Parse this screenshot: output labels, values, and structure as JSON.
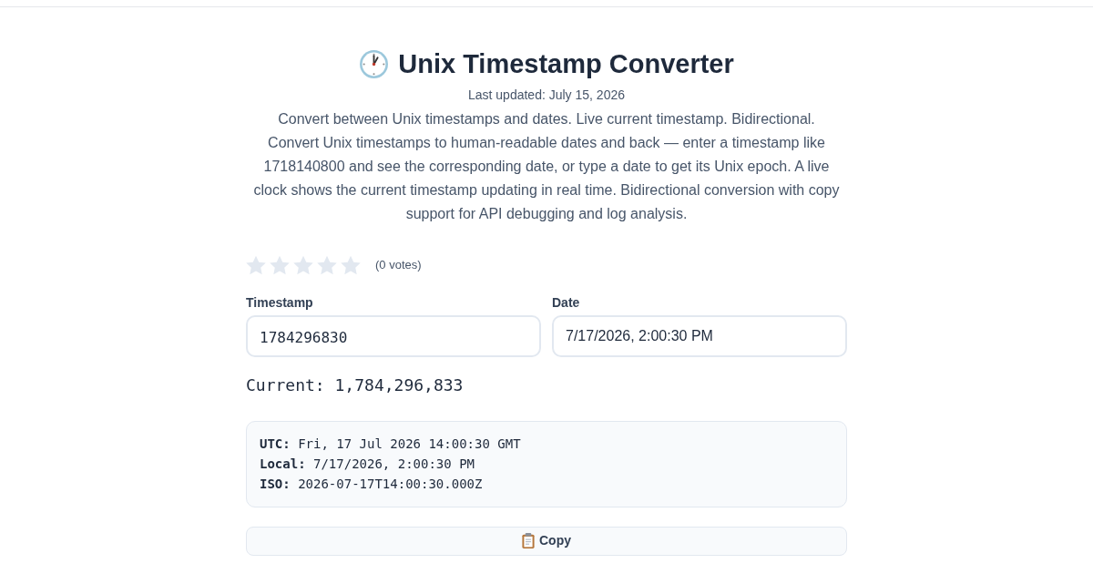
{
  "page": {
    "title": "Unix Timestamp Converter",
    "updated": "Last updated: July 15, 2026",
    "description": "Convert between Unix timestamps and dates. Live current timestamp. Bidirectional. Convert Unix timestamps to human-readable dates and back — enter a timestamp like 1718140800 and see the corresponding date, or type a date to get its Unix epoch. A live clock shows the current timestamp updating in real time. Bidirectional conversion with copy support for API debugging and log analysis."
  },
  "rating": {
    "stars": 0,
    "votes": "(0 votes)"
  },
  "fields": [
    {
      "kind": "mono",
      "label": "Timestamp",
      "value": "1784296830"
    },
    {
      "kind": "text",
      "label": "Date",
      "value": "7/17/2026, 2:00:30 PM"
    }
  ],
  "current": "Current: 1,784,296,833",
  "results": [
    "**UTC:** Fri, 17 Jul 2026 14:00:30 GMT",
    "**Local:** 7/17/2026, 2:00:30 PM",
    "**ISO:** 2026-07-17T14:00:30.000Z"
  ],
  "copy_button": {
    "label": "Copy"
  }
}
